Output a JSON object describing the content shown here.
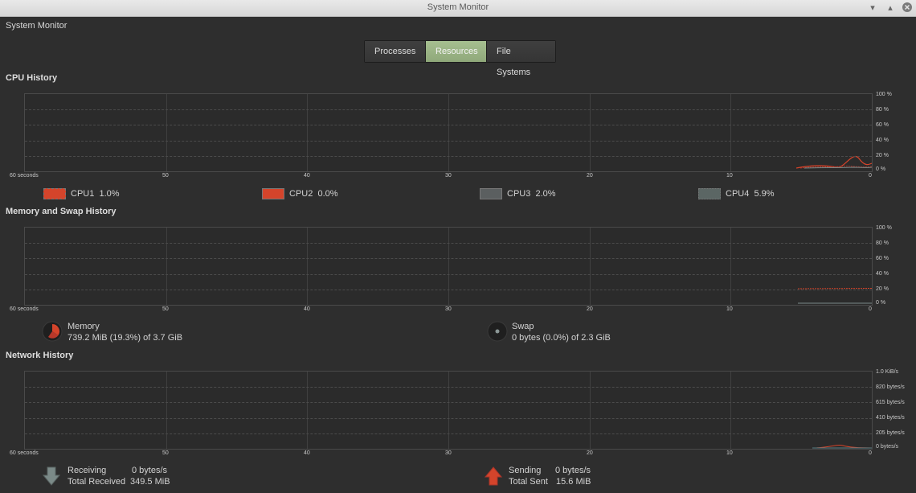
{
  "window": {
    "title": "System Monitor"
  },
  "app_name": "System Monitor",
  "tabs": [
    {
      "label": "Processes"
    },
    {
      "label": "Resources"
    },
    {
      "label": "File Systems"
    }
  ],
  "cpu": {
    "title": "CPU History",
    "x_ticks": [
      "60 seconds",
      "50",
      "40",
      "30",
      "20",
      "10",
      "0"
    ],
    "y_ticks": [
      "100 %",
      "80 %",
      "60 %",
      "40 %",
      "20 %",
      "0 %"
    ],
    "legend": [
      {
        "name": "CPU1",
        "value": "1.0%",
        "color": "#d4442b"
      },
      {
        "name": "CPU2",
        "value": "0.0%",
        "color": "#d4442b"
      },
      {
        "name": "CPU3",
        "value": "2.0%",
        "color": "#5b5f60"
      },
      {
        "name": "CPU4",
        "value": "5.9%",
        "color": "#5b6664"
      }
    ]
  },
  "memory": {
    "title": "Memory and Swap History",
    "x_ticks": [
      "60 seconds",
      "50",
      "40",
      "30",
      "20",
      "10",
      "0"
    ],
    "y_ticks": [
      "100 %",
      "80 %",
      "60 %",
      "40 %",
      "20 %",
      "0 %"
    ],
    "mem_label": "Memory",
    "mem_value": "739.2 MiB (19.3%) of 3.7 GiB",
    "swap_label": "Swap",
    "swap_value": "0 bytes (0.0%) of 2.3 GiB",
    "mem_color": "#d4442b"
  },
  "network": {
    "title": "Network History",
    "x_ticks": [
      "60 seconds",
      "50",
      "40",
      "30",
      "20",
      "10",
      "0"
    ],
    "y_ticks": [
      "1.0 KiB/s",
      "820 bytes/s",
      "615 bytes/s",
      "410 bytes/s",
      "205 bytes/s",
      "0 bytes/s"
    ],
    "receiving_label": "Receiving",
    "receiving_value": "0 bytes/s",
    "total_received_label": "Total Received",
    "total_received_value": "349.5 MiB",
    "sending_label": "Sending",
    "sending_value": "0 bytes/s",
    "total_sent_label": "Total Sent",
    "total_sent_value": "15.6 MiB"
  }
}
